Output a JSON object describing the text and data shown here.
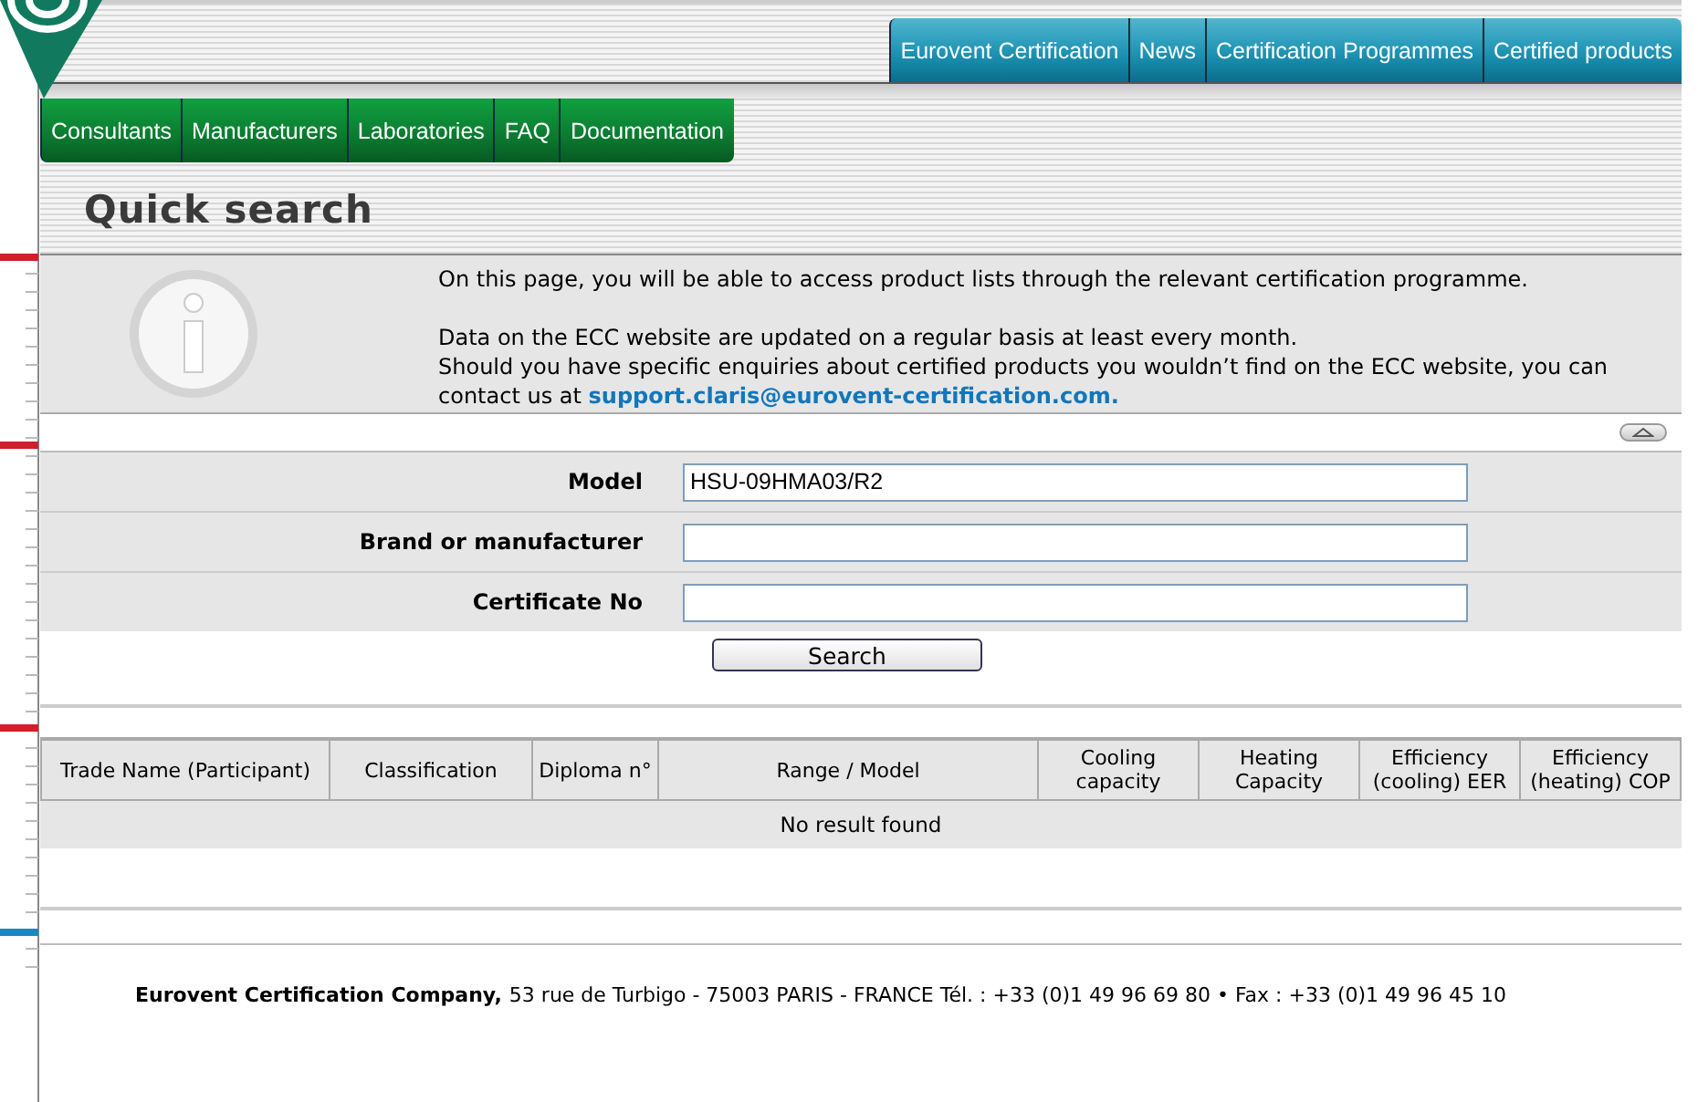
{
  "top_nav": [
    {
      "label": "Eurovent Certification"
    },
    {
      "label": "News"
    },
    {
      "label": "Certification Programmes"
    },
    {
      "label": "Certified products"
    }
  ],
  "sub_nav": [
    {
      "label": "Consultants"
    },
    {
      "label": "Manufacturers"
    },
    {
      "label": "Laboratories"
    },
    {
      "label": "FAQ"
    },
    {
      "label": "Documentation"
    }
  ],
  "page_title": "Quick search",
  "info": {
    "lines": [
      "On this page, you will be able to access product lists through the relevant certification programme.",
      "Data on the ECC website are updated on a regular basis at least every month.",
      "Should you have specific enquiries about certified products you wouldn’t find on the ECC website, you can contact us at"
    ],
    "email": "support.claris@eurovent-certification.com."
  },
  "form": {
    "fields": [
      {
        "label": "Model",
        "value": "HSU-09HMA03/R2"
      },
      {
        "label": "Brand or manufacturer"
      },
      {
        "label": "Certificate No"
      }
    ],
    "button": "Search"
  },
  "table": {
    "columns": [
      "Trade Name (Participant)",
      "Classification",
      "Diploma n°",
      "Range / Model",
      "Cooling capacity",
      "Heating Capacity",
      "Efficiency (cooling) EER",
      "Efficiency (heating) COP"
    ],
    "empty_message": "No result found"
  },
  "footer": {
    "company": "Eurovent Certification Company,",
    "address": "53 rue de Turbigo - 75003 PARIS - FRANCE Tél. : +33 (0)1 49 96 69 80 • Fax : +33 (0)1 49 96 45 10"
  }
}
